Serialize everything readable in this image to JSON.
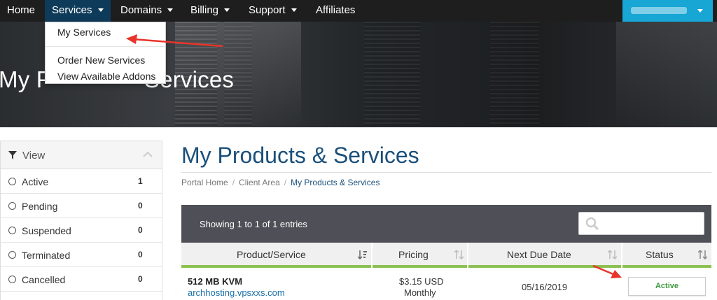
{
  "nav": {
    "home": "Home",
    "services": "Services",
    "domains": "Domains",
    "billing": "Billing",
    "support": "Support",
    "affiliates": "Affiliates"
  },
  "dropdown": {
    "my_services": "My Services",
    "order_new": "Order New Services",
    "view_addons": "View Available Addons"
  },
  "hero": {
    "title_left": "My P",
    "title_right": "Services"
  },
  "sidebar": {
    "header": "View",
    "items": [
      {
        "label": "Active",
        "count": "1"
      },
      {
        "label": "Pending",
        "count": "0"
      },
      {
        "label": "Suspended",
        "count": "0"
      },
      {
        "label": "Terminated",
        "count": "0"
      },
      {
        "label": "Cancelled",
        "count": "0"
      }
    ]
  },
  "main": {
    "title": "My Products & Services",
    "breadcrumb": [
      "Portal Home",
      "Client Area",
      "My Products & Services"
    ],
    "showing": "Showing 1 to 1 of 1 entries",
    "search_placeholder": "",
    "columns": [
      "Product/Service",
      "Pricing",
      "Next Due Date",
      "Status"
    ],
    "rows": [
      {
        "product": "512 MB KVM",
        "domain": "archhosting.vpsxxs.com",
        "price": "$3.15 USD",
        "cycle": "Monthly",
        "due": "05/16/2019",
        "status": "Active"
      }
    ]
  },
  "colors": {
    "nav_bg": "#1e1e1e",
    "nav_active": "#0f3b5a",
    "account_bg": "#18a6d4",
    "title_blue": "#1a4f7a",
    "table_bar": "#4f4f57",
    "accent_green": "#8cc152",
    "arrow_red": "#e8342a"
  }
}
